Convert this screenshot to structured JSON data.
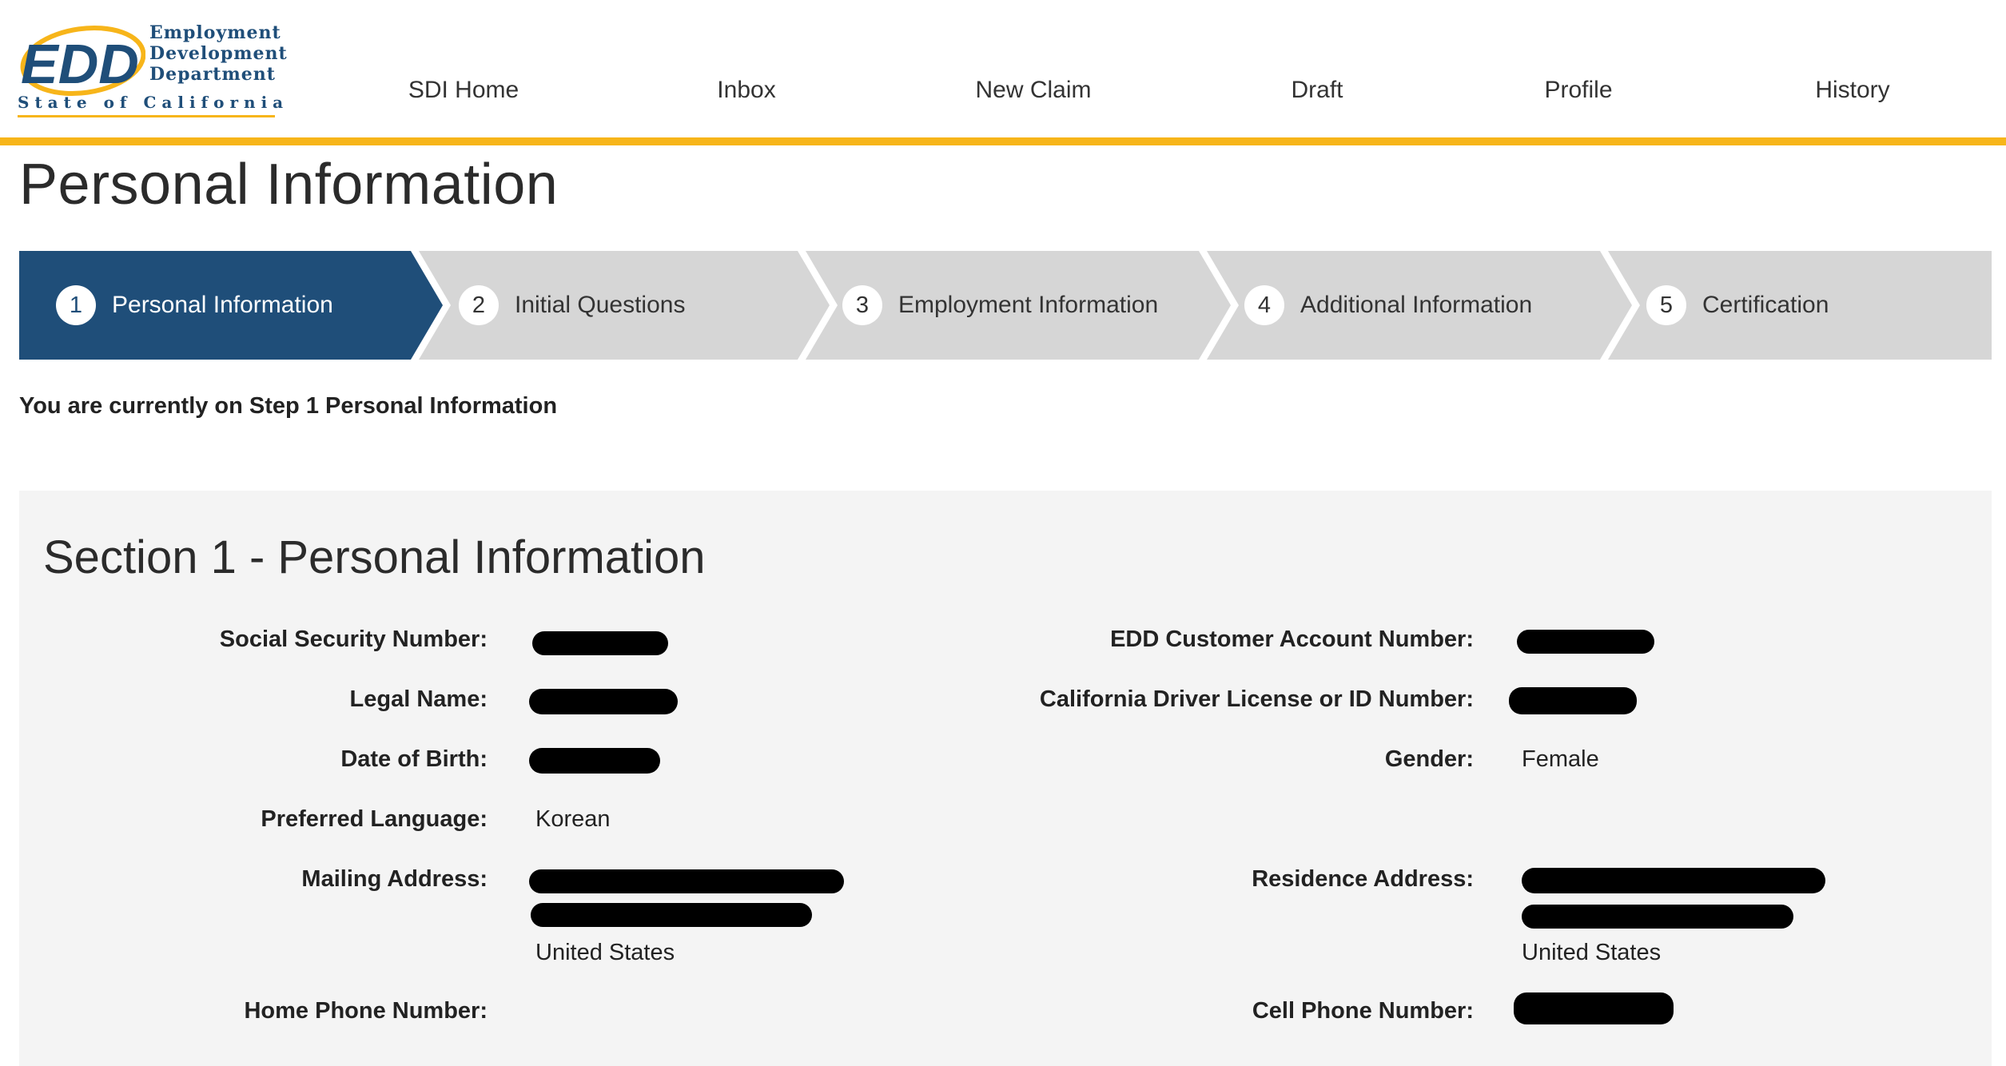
{
  "header": {
    "logo": {
      "mark": "EDD",
      "dept_lines": [
        "Employment",
        "Development",
        "Department"
      ],
      "state": "State of California"
    },
    "nav": [
      "SDI Home",
      "Inbox",
      "New Claim",
      "Draft",
      "Profile",
      "History"
    ]
  },
  "page_title": "Personal Information",
  "stepper": {
    "steps": [
      {
        "num": "1",
        "label": "Personal Information",
        "active": true
      },
      {
        "num": "2",
        "label": "Initial Questions",
        "active": false
      },
      {
        "num": "3",
        "label": "Employment Information",
        "active": false
      },
      {
        "num": "4",
        "label": "Additional Information",
        "active": false
      },
      {
        "num": "5",
        "label": "Certification",
        "active": false
      }
    ],
    "current_text": "You are currently on Step 1 Personal Information"
  },
  "section": {
    "title": "Section 1 - Personal Information",
    "left": {
      "ssn_label": "Social Security Number:",
      "legal_name_label": "Legal Name:",
      "dob_label": "Date of Birth:",
      "language_label": "Preferred Language:",
      "language_value": "Korean",
      "mailing_label": "Mailing Address:",
      "mailing_country": "United States",
      "home_phone_label": "Home Phone Number:"
    },
    "right": {
      "customer_acct_label": "EDD Customer Account Number:",
      "license_label": "California Driver License or ID Number:",
      "gender_label": "Gender:",
      "gender_value": "Female",
      "residence_label": "Residence Address:",
      "residence_country": "United States",
      "cell_phone_label": "Cell Phone Number:"
    }
  },
  "colors": {
    "brand_blue": "#1f4e79",
    "accent_gold": "#f7b51a",
    "step_inactive": "#d6d6d6",
    "panel_bg": "#f4f4f4"
  }
}
